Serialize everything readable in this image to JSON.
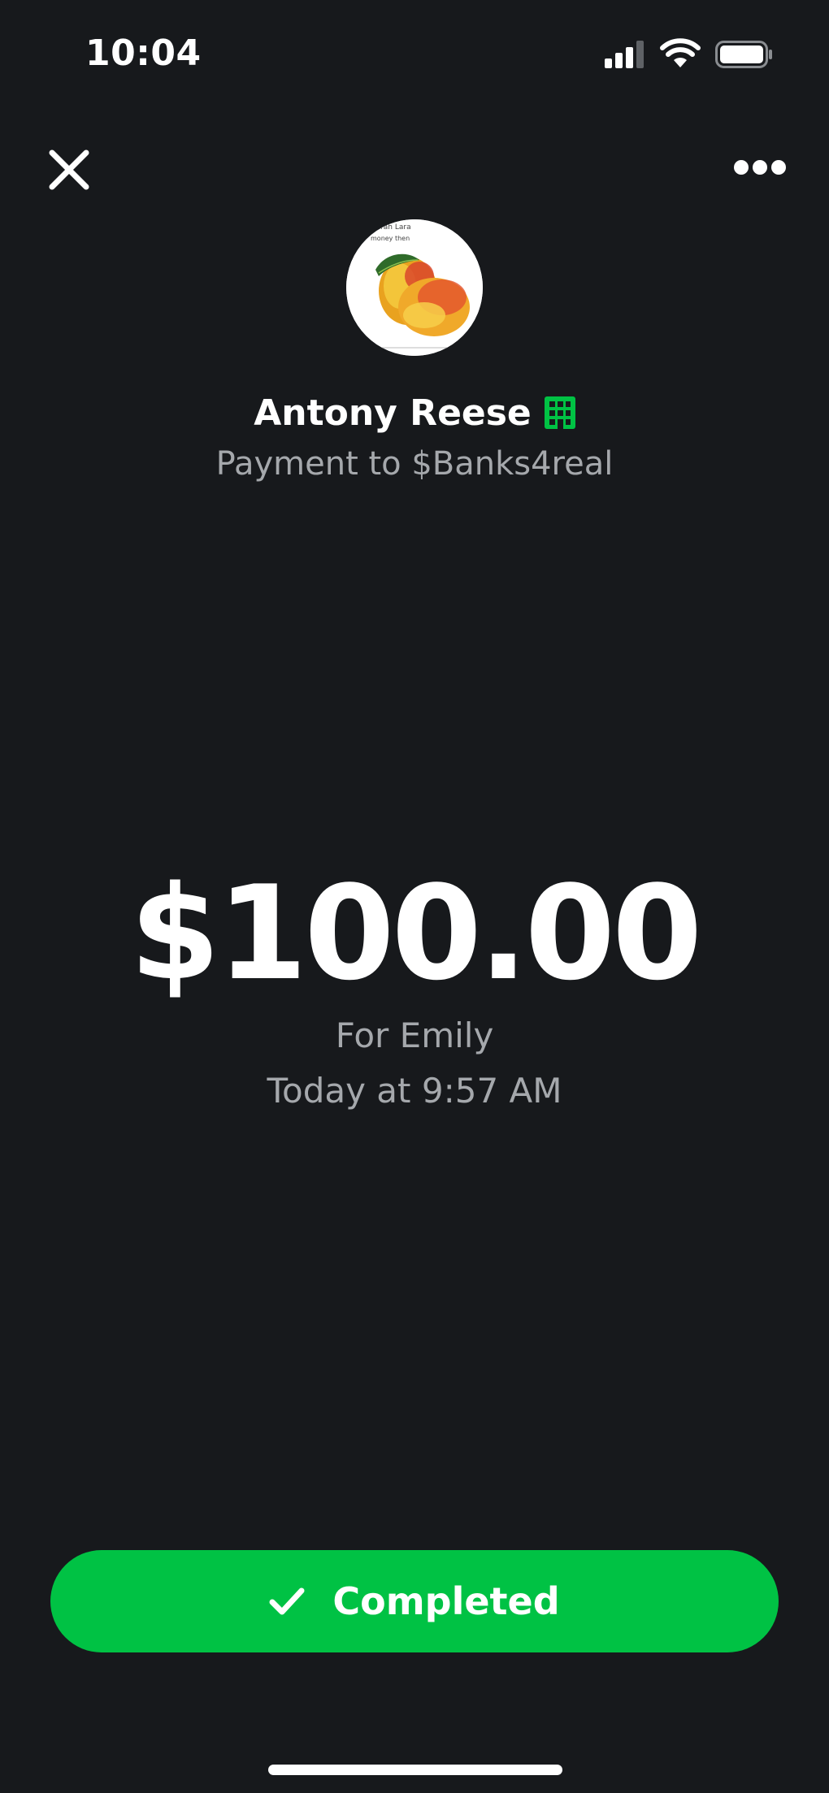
{
  "status_bar": {
    "time": "10:04",
    "signal_icon": "cellular-signal-icon",
    "wifi_icon": "wifi-icon",
    "battery_icon": "battery-icon"
  },
  "header": {
    "close_icon": "close-icon",
    "more_icon": "more-options-icon"
  },
  "recipient": {
    "avatar": "mango-photo-avatar",
    "avatar_caption_line1": "...orah Lara",
    "avatar_caption_line2": "money then",
    "name": "Antony Reese",
    "business_icon": "business-building-icon",
    "payment_to": "Payment to $Banks4real"
  },
  "transaction": {
    "amount": "$100.00",
    "note": "For Emily",
    "timestamp": "Today at 9:57 AM"
  },
  "status_button": {
    "label": "Completed",
    "icon": "checkmark-icon"
  },
  "colors": {
    "background": "#17191c",
    "accent_green": "#00c244",
    "secondary_text": "#a5a8ac",
    "primary_text": "#ffffff"
  }
}
